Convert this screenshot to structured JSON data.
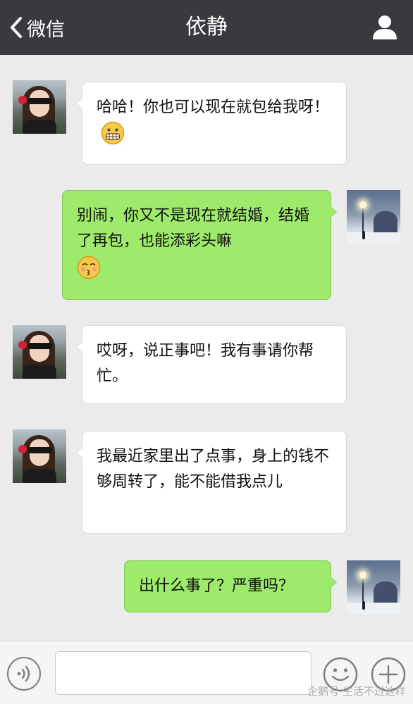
{
  "header": {
    "back_label": "微信",
    "title": "依静"
  },
  "messages": [
    {
      "sender": "contact",
      "text": "哈哈！你也可以现在就包给我呀！",
      "emoji": "grimacing-face-emoji"
    },
    {
      "sender": "self",
      "text": "别闹，你又不是现在就结婚，结婚了再包，也能添彩头嘛",
      "emoji": "kissing-face-emoji"
    },
    {
      "sender": "contact",
      "text": "哎呀，说正事吧！我有事请你帮忙。"
    },
    {
      "sender": "contact",
      "text": "我最近家里出了点事，身上的钱不够周转了，能不能借我点儿"
    },
    {
      "sender": "self",
      "text": "出什么事了？严重吗？"
    }
  ],
  "input": {
    "value": ""
  },
  "watermark": "企鹅号 生活不过这样",
  "colors": {
    "header_bg": "#393a3f",
    "chat_bg": "#ebebeb",
    "incoming_bubble": "#ffffff",
    "outgoing_bubble": "#9eea6a"
  }
}
